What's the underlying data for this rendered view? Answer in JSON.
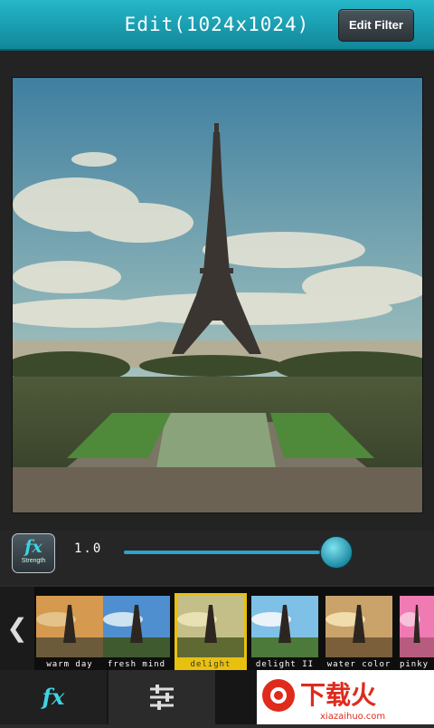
{
  "header": {
    "title": "Edit(1024x1024)",
    "edit_filter_label": "Edit Filter"
  },
  "strength": {
    "icon_label": "fx",
    "icon_caption": "Strength",
    "value_text": "1.0",
    "slider_fraction": 0.9
  },
  "filters": [
    {
      "name": "warm day",
      "selected": false
    },
    {
      "name": "fresh mind",
      "selected": false
    },
    {
      "name": "delight",
      "selected": true
    },
    {
      "name": "delight II",
      "selected": false
    },
    {
      "name": "water color",
      "selected": false
    },
    {
      "name": "pinky",
      "selected": false
    }
  ],
  "tabs": {
    "fx_label": "fx"
  },
  "watermark": {
    "text": "下载火",
    "site": "xiazaihuo.com"
  },
  "colors": {
    "accent": "#25b7c9",
    "selected": "#e8c10e"
  }
}
